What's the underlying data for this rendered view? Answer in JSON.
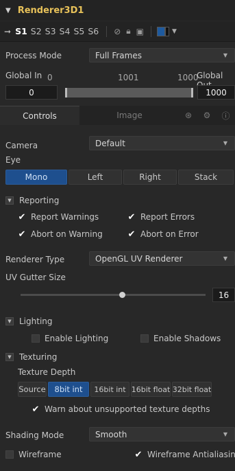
{
  "node": {
    "title": "Renderer3D1"
  },
  "versions": {
    "items": [
      "S1",
      "S2",
      "S3",
      "S4",
      "S5",
      "S6"
    ],
    "active": "S1"
  },
  "process_mode": {
    "label": "Process Mode",
    "value": "Full Frames"
  },
  "global_range": {
    "in_label": "Global In",
    "out_label": "Global Out",
    "start": "0",
    "mid": "1001",
    "end": "1000",
    "in_value": "0",
    "out_value": "1000"
  },
  "tabs": {
    "controls": "Controls",
    "image": "Image"
  },
  "camera": {
    "label": "Camera",
    "value": "Default"
  },
  "eye": {
    "label": "Eye",
    "options": [
      "Mono",
      "Left",
      "Right",
      "Stack"
    ],
    "active": "Mono"
  },
  "reporting": {
    "label": "Reporting",
    "report_warnings": "Report Warnings",
    "report_errors": "Report Errors",
    "abort_on_warning": "Abort on Warning",
    "abort_on_error": "Abort on Error"
  },
  "renderer_type": {
    "label": "Renderer Type",
    "value": "OpenGL UV Renderer"
  },
  "uv_gutter": {
    "label": "UV Gutter Size",
    "value": "16",
    "fraction": 0.53
  },
  "lighting": {
    "label": "Lighting",
    "enable_lighting": "Enable Lighting",
    "enable_shadows": "Enable Shadows"
  },
  "texturing": {
    "label": "Texturing",
    "depth_label": "Texture Depth",
    "options": [
      "Source",
      "8bit int",
      "16bit int",
      "16bit float",
      "32bit float"
    ],
    "active": "8bit int",
    "warn": "Warn about unsupported texture depths"
  },
  "shading_mode": {
    "label": "Shading Mode",
    "value": "Smooth"
  },
  "wireframe": {
    "label": "Wireframe",
    "antialiasing": "Wireframe Antialiasing"
  },
  "colors": {
    "accent": "#1e4f8e",
    "title": "#e8c25a"
  }
}
